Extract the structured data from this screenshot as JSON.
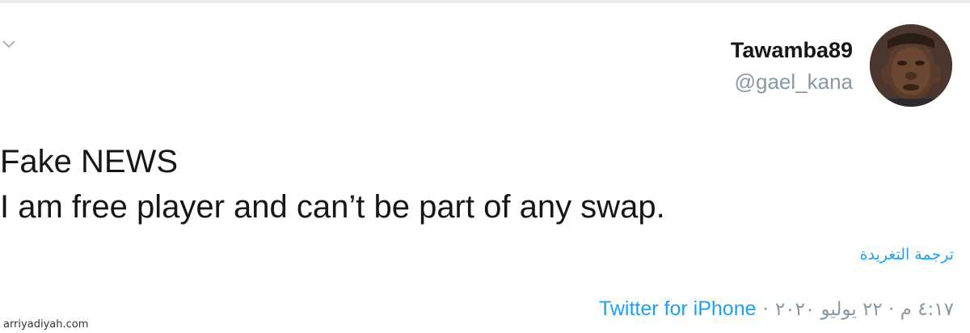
{
  "tweet": {
    "display_name": "Tawamba89",
    "handle": "@gael_kana",
    "text_lines": [
      "Fake NEWS",
      "I am free player and can’t be part of any swap."
    ],
    "translate_label": "ترجمة التغريدة",
    "timestamp": "٤:١٧ م · ٢٢ يوليو ٢٠٢٠",
    "separator": "·",
    "source_label": "Twitter for iPhone",
    "icons": {
      "caret": "chevron-down-icon",
      "avatar": "profile-photo"
    },
    "colors": {
      "link": "#1da1f2",
      "muted": "#8899a6",
      "text": "#14171a"
    }
  },
  "watermark": "arriyadiyah.com"
}
